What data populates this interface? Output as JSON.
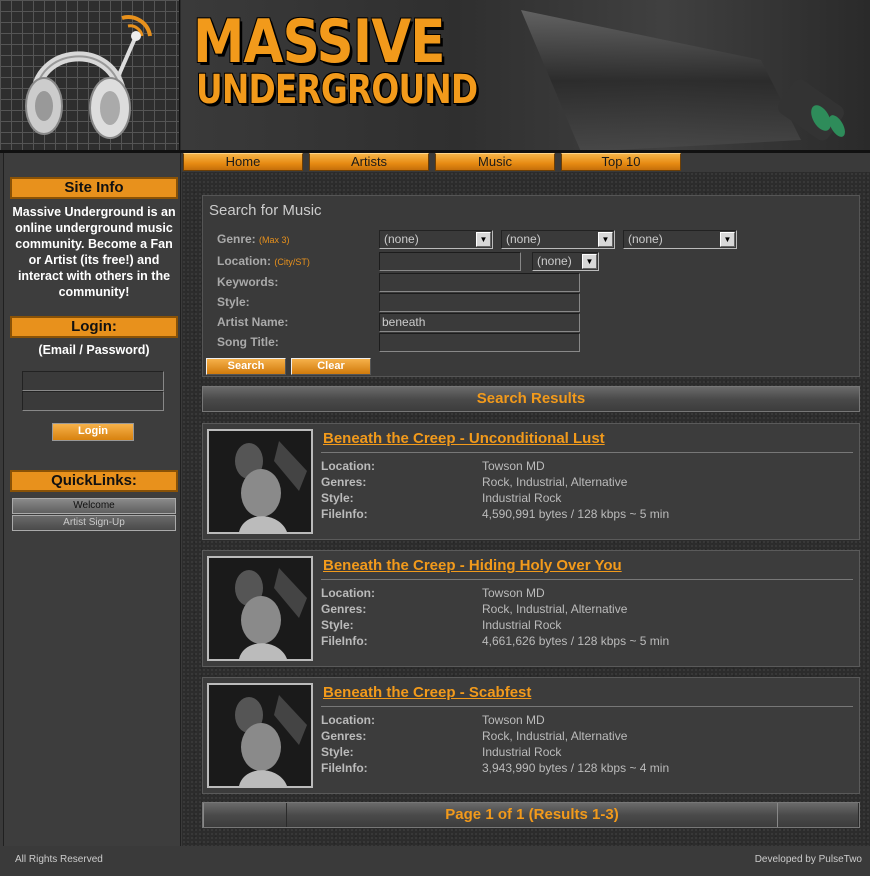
{
  "header": {
    "brand_title": "MASSIVE",
    "brand_subtitle": "UNDERGROUND",
    "accent_color": "#f29a1b"
  },
  "nav": {
    "tabs": [
      {
        "label": "Home"
      },
      {
        "label": "Artists"
      },
      {
        "label": "Music"
      },
      {
        "label": "Top 10"
      }
    ]
  },
  "sidebar": {
    "site_info_heading": "Site Info",
    "site_info_text": "Massive Underground is an online underground music community. Become a Fan or Artist (its free!) and interact with others in the community!",
    "login_heading": "Login:",
    "login_hint": "(Email / Password)",
    "email_value": "",
    "password_value": "",
    "login_button": "Login",
    "quicklinks_heading": "QuickLinks:",
    "quicklinks": [
      {
        "label": "Welcome"
      },
      {
        "label": "Artist Sign-Up"
      }
    ]
  },
  "search": {
    "title": "Search for Music",
    "genre_label": "Genre:",
    "genre_hint": "(Max 3)",
    "genre_selects": [
      "(none)",
      "(none)",
      "(none)"
    ],
    "location_label": "Location:",
    "location_hint": "(City/ST)",
    "location_value": "",
    "location_select": "(none)",
    "keywords_label": "Keywords:",
    "keywords_value": "",
    "style_label": "Style:",
    "style_value": "",
    "artist_label": "Artist Name:",
    "artist_value": "beneath",
    "song_label": "Song Title:",
    "song_value": "",
    "search_button": "Search",
    "clear_button": "Clear"
  },
  "results": {
    "heading": "Search Results",
    "labels": {
      "location": "Location:",
      "genres": "Genres:",
      "style": "Style:",
      "fileinfo": "FileInfo:"
    },
    "items": [
      {
        "title": "Beneath the Creep - Unconditional Lust",
        "location": "Towson MD",
        "genres": "Rock, Industrial, Alternative",
        "style": "Industrial Rock",
        "fileinfo": "4,590,991 bytes / 128 kbps ~ 5 min"
      },
      {
        "title": "Beneath the Creep - Hiding Holy Over You",
        "location": "Towson MD",
        "genres": "Rock, Industrial, Alternative",
        "style": "Industrial Rock",
        "fileinfo": "4,661,626 bytes / 128 kbps ~ 5 min"
      },
      {
        "title": "Beneath the Creep - Scabfest",
        "location": "Towson MD",
        "genres": "Rock, Industrial, Alternative",
        "style": "Industrial Rock",
        "fileinfo": "3,943,990 bytes / 128 kbps ~ 4 min"
      }
    ],
    "pager_text": "Page 1 of 1 (Results 1-3)"
  },
  "footer": {
    "left": "All Rights Reserved",
    "right": "Developed by PulseTwo"
  }
}
